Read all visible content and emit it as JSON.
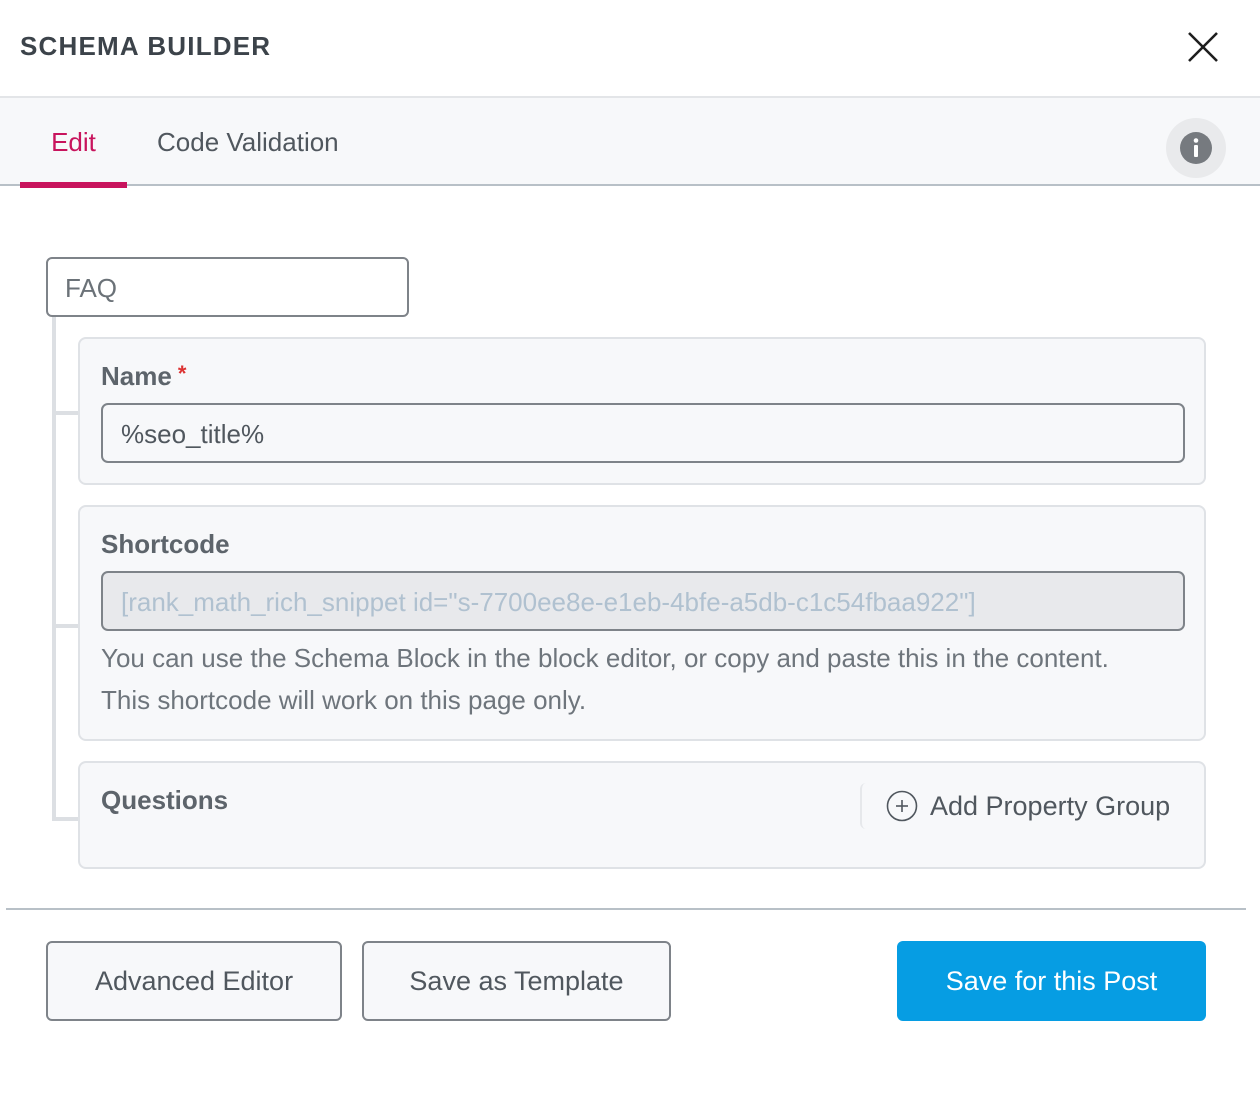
{
  "header": {
    "title": "SCHEMA BUILDER",
    "close_icon": "close-icon"
  },
  "tabs": [
    {
      "label": "Edit",
      "active": true
    },
    {
      "label": "Code Validation",
      "active": false
    }
  ],
  "info_icon": "info-icon",
  "schema": {
    "type": "FAQ",
    "fields": {
      "name": {
        "label": "Name",
        "required_marker": "*",
        "value": "%seo_title%"
      },
      "shortcode": {
        "label": "Shortcode",
        "value": "[rank_math_rich_snippet id=\"s-7700ee8e-e1eb-4bfe-a5db-c1c54fbaa922\"]",
        "help": "You can use the Schema Block in the block editor, or copy and paste this in the content. This shortcode will work on this page only."
      },
      "questions": {
        "label": "Questions",
        "add_button": "Add Property Group",
        "add_icon": "plus-circle-icon"
      }
    }
  },
  "footer": {
    "advanced_editor": "Advanced Editor",
    "save_template": "Save as Template",
    "save_post": "Save for this Post"
  },
  "colors": {
    "accent": "#c8145d",
    "primary_button": "#069de3",
    "required": "#dc3232"
  }
}
